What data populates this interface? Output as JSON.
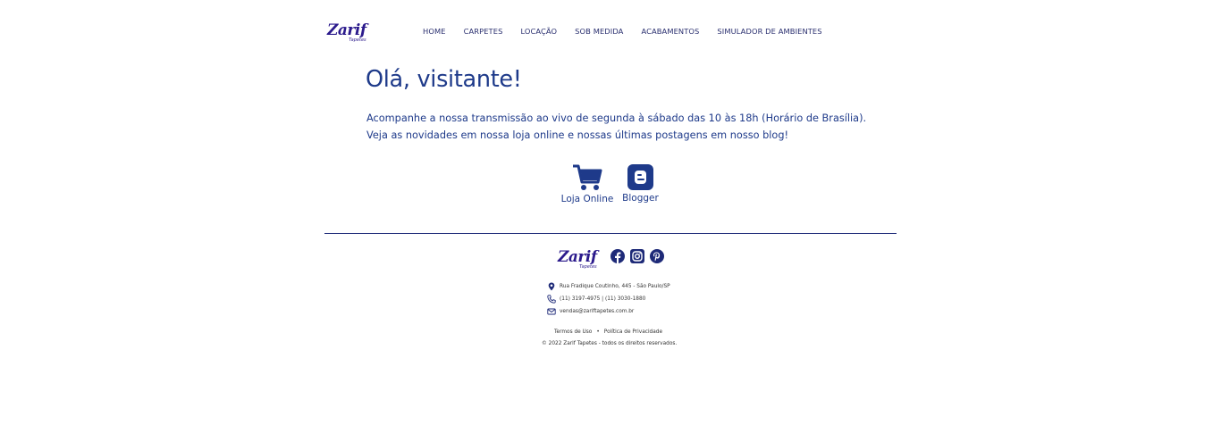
{
  "brand": {
    "name": "Zarif",
    "tagline": "Tapetes",
    "color": "#2b1a8c"
  },
  "nav": {
    "items": [
      {
        "label": "HOME"
      },
      {
        "label": "CARPETES"
      },
      {
        "label": "LOCAÇÃO"
      },
      {
        "label": "SOB MEDIDA"
      },
      {
        "label": "ACABAMENTOS"
      },
      {
        "label": "SIMULADOR DE AMBIENTES"
      }
    ]
  },
  "main": {
    "greeting": "Olá, visitante!",
    "intro_line_1": "Acompanhe a nossa transmissão ao vivo de segunda à sábado das 10 às 18h (Horário de Brasília).",
    "intro_line_2": "Veja as novidades em nossa loja online e nossas últimas postagens em nosso blog!",
    "shortcuts": [
      {
        "label": "Loja Online",
        "icon": "shopping-cart-icon"
      },
      {
        "label": "Blogger",
        "icon": "blogger-icon"
      }
    ],
    "accent_color": "#1e3a8a"
  },
  "footer": {
    "social": [
      {
        "icon": "facebook-icon"
      },
      {
        "icon": "instagram-icon"
      },
      {
        "icon": "pinterest-icon"
      }
    ],
    "address": "Rua Fradique Coutinho, 445 - São Paulo/SP",
    "phone": "(11) 3197-4975 | (11) 3030-1880",
    "email": "vendas@zariftapetes.com.br",
    "terms_label": "Termos de Uso",
    "separator": "•",
    "privacy_label": "Política de Privacidade",
    "copyright": "© 2022 Zarif Tapetes - todos os direitos reservados."
  }
}
